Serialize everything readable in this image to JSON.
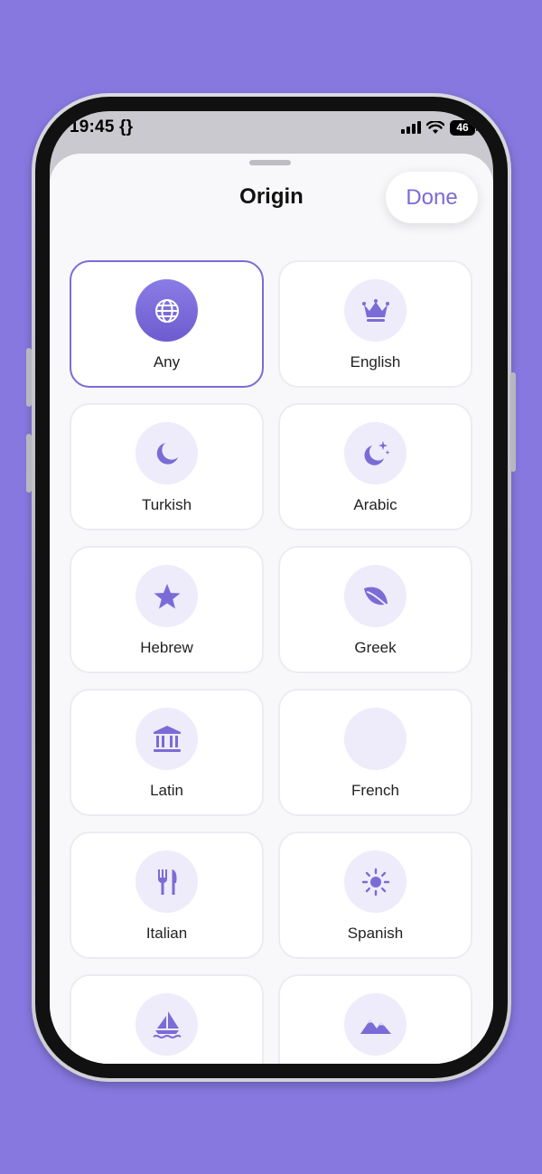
{
  "status_bar": {
    "time": "19:45 {}",
    "battery": "46"
  },
  "sheet": {
    "title": "Origin",
    "done_label": "Done"
  },
  "colors": {
    "accent": "#7B6BD6",
    "background": "#8778E0",
    "icon_bg": "#EEEBFB"
  },
  "origins": [
    {
      "label": "Any",
      "icon": "globe-icon",
      "selected": true
    },
    {
      "label": "English",
      "icon": "crown-icon",
      "selected": false
    },
    {
      "label": "Turkish",
      "icon": "moon-icon",
      "selected": false
    },
    {
      "label": "Arabic",
      "icon": "moon-stars-icon",
      "selected": false
    },
    {
      "label": "Hebrew",
      "icon": "star-icon",
      "selected": false
    },
    {
      "label": "Greek",
      "icon": "leaf-icon",
      "selected": false
    },
    {
      "label": "Latin",
      "icon": "building-columns-icon",
      "selected": false
    },
    {
      "label": "French",
      "icon": "blank-icon",
      "selected": false
    },
    {
      "label": "Italian",
      "icon": "fork-knife-icon",
      "selected": false
    },
    {
      "label": "Spanish",
      "icon": "sun-icon",
      "selected": false
    },
    {
      "label": "",
      "icon": "sailboat-icon",
      "selected": false
    },
    {
      "label": "",
      "icon": "mountains-icon",
      "selected": false
    }
  ]
}
